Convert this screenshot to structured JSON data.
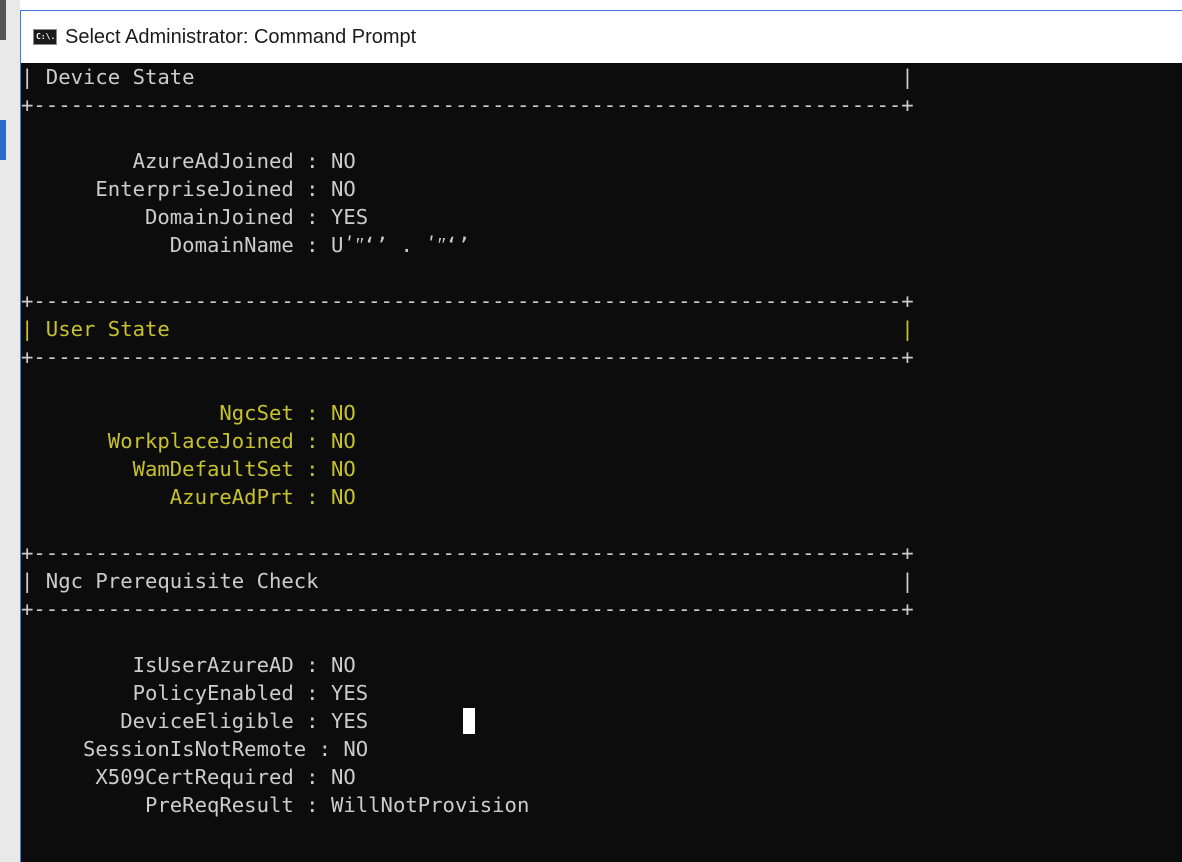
{
  "window": {
    "title": "Select Administrator: Command Prompt",
    "icon": "cmd-icon",
    "icon_text": "C:\\."
  },
  "colors": {
    "text": "#cccccc",
    "highlight": "#c7c12d",
    "background": "#0c0c0c"
  },
  "console": {
    "lines": [
      "| Device State                                                         |",
      "+----------------------------------------------------------------------+",
      "",
      "",
      "         AzureAdJoined : NO",
      "      EnterpriseJoined : NO",
      "          DomainJoined : YES",
      "            DomainName : Uʹʺʻʼ . ʹʺʻʼ",
      "",
      "",
      "+----------------------------------------------------------------------+",
      "| User State                                                           |",
      "+----------------------------------------------------------------------+",
      "",
      "",
      "                NgcSet : NO",
      "       WorkplaceJoined : NO",
      "         WamDefaultSet : NO",
      "            AzureAdPrt : NO",
      "",
      "",
      "+----------------------------------------------------------------------+",
      "| Ngc Prerequisite Check                                               |",
      "+----------------------------------------------------------------------+",
      "",
      "",
      "         IsUserAzureAD : NO",
      "         PolicyEnabled : YES",
      "        DeviceEligible : YES",
      "     SessionIsNotRemote : NO",
      "      X509CertRequired : NO",
      "          PreReqResult : WillNotProvision"
    ]
  }
}
